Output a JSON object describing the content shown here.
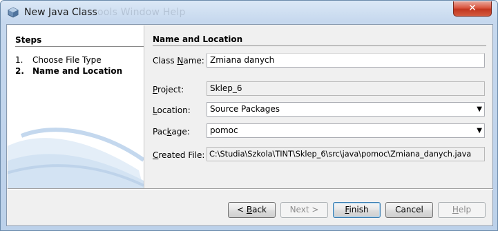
{
  "window": {
    "title": "New Java Class",
    "background_menu_text": "ools  Window  Help",
    "close_symbol": "✕"
  },
  "steps": {
    "heading": "Steps",
    "items": [
      {
        "num": "1.",
        "label": "Choose File Type",
        "current": false
      },
      {
        "num": "2.",
        "label": "Name and Location",
        "current": true
      }
    ]
  },
  "form": {
    "heading": "Name and Location",
    "class_name": {
      "label_pre": "Class ",
      "label_u": "N",
      "label_post": "ame:",
      "value": "Zmiana  danych"
    },
    "project": {
      "label_pre": "",
      "label_u": "P",
      "label_post": "roject:",
      "value": "Sklep_6"
    },
    "location": {
      "label_pre": "",
      "label_u": "L",
      "label_post": "ocation:",
      "value": "Source Packages"
    },
    "package": {
      "label_pre": "Pac",
      "label_u": "k",
      "label_post": "age:",
      "value": "pomoc"
    },
    "created_file": {
      "label_pre": "",
      "label_u": "C",
      "label_post": "reated File:",
      "value": "C:\\Studia\\Szkola\\TINT\\Sklep_6\\src\\java\\pomoc\\Zmiana_danych.java"
    }
  },
  "buttons": {
    "back": {
      "label_pre": "< ",
      "label_u": "B",
      "label_post": "ack"
    },
    "next": {
      "label": "Next >"
    },
    "finish": {
      "label_pre": "",
      "label_u": "F",
      "label_post": "inish"
    },
    "cancel": {
      "label": "Cancel"
    },
    "help": {
      "label_pre": "",
      "label_u": "H",
      "label_post": "elp"
    }
  },
  "colors": {
    "title_bar": "#c6d8ee",
    "close_button": "#c2361f",
    "dialog_bg": "#f0f0f0",
    "default_button_border": "#3c7fb1"
  }
}
